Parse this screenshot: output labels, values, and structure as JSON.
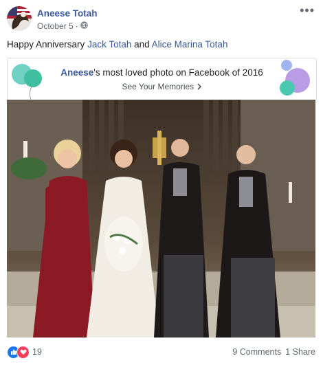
{
  "post": {
    "author": "Aneese Totah",
    "date": "October 5",
    "date_separator": " · ",
    "more_label": "•••",
    "message": {
      "prefix": "Happy Anniversary ",
      "mention1": "Jack Totah",
      "connector": " and ",
      "mention2": "Alice Marina Totah"
    }
  },
  "memory_card": {
    "name": "Aneese",
    "title_rest": "'s most loved photo on Facebook of 2016",
    "cta": "See Your Memories"
  },
  "footer": {
    "reaction_count": "19",
    "comments": "9 Comments",
    "shares": "1 Share"
  },
  "colors": {
    "link": "#385898",
    "like": "#1877f2",
    "love": "#f33e58",
    "balloon_teal": "#45c7b0",
    "balloon_purple": "#a78bdc"
  },
  "icons": [
    "globe-icon",
    "chevron-right-icon",
    "like-icon",
    "love-icon",
    "more-icon"
  ]
}
